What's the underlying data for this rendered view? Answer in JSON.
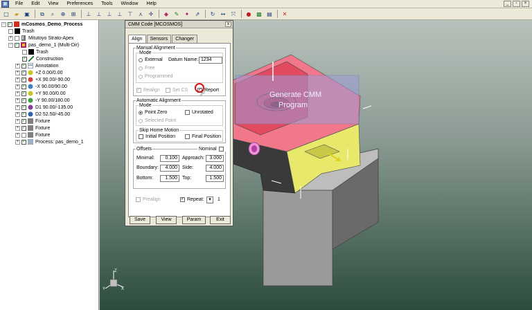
{
  "menubar": {
    "items": [
      "File",
      "Edit",
      "View",
      "Preferences",
      "Tools",
      "Window",
      "Help"
    ]
  },
  "tree": {
    "root": "mCosmos_Demo_Process",
    "items": [
      "Trash",
      "Mitutoyo Strato-Apex",
      "pas_demo_1 (Multi-Dir)",
      "Trash",
      "Construction",
      "Annotation",
      "+Z 0.00/0.00",
      "+X 90.00/-90.00",
      "-X 90.00/90.00",
      "+Y 90.00/0.00",
      "-Y 90.00/180.00",
      "D1 90.00/-135.00",
      "D2 52.50/-45.00",
      "Fixture",
      "Fixture",
      "Fixture",
      "Process: pas_demo_1"
    ]
  },
  "dialog": {
    "title": "CMM Code [MCOSMOS]",
    "close": "x",
    "tabs": [
      "Align",
      "Sensors",
      "Changer"
    ],
    "manual": {
      "title": "Manual Alignment",
      "mode_title": "Mode",
      "external": "External",
      "datum_label": "Datum Name:",
      "datum_value": "1234",
      "free": "Free",
      "programmed": "Programmed",
      "realign": "Realign",
      "setcs": "Set CS",
      "report": "Report"
    },
    "automatic": {
      "title": "Automatic Alignment",
      "mode_title": "Mode",
      "point_zero": "Point Zero",
      "unrotated": "Unrotated",
      "selected_point": "Selected Point"
    },
    "skip": {
      "title": "Skip Home Motion",
      "initial": "Initial Position",
      "final": "Final Position"
    },
    "offsets": {
      "title": "Offsets",
      "nominal": "Nominal",
      "minimal_label": "Minimal:",
      "minimal": "0.100",
      "approach_label": "Approach:",
      "approach": "3.000",
      "boundary_label": "Boundary:",
      "boundary": "4.000",
      "side_label": "Side:",
      "side": "4.000",
      "bottom_label": "Bottom:",
      "bottom": "1.500",
      "top_label": "Top:",
      "top": "1.500"
    },
    "prealign": "Prealign",
    "repeat": "Repeat:",
    "repeat_value": "1",
    "buttons": {
      "save": "Save",
      "view": "View",
      "param": "Param",
      "exit": "Exit"
    }
  },
  "viewport": {
    "overlay_line1": "Generate CMM",
    "overlay_line2": "Program",
    "axis_z": "Z",
    "axis_y": "Y",
    "axis_x": "X"
  }
}
